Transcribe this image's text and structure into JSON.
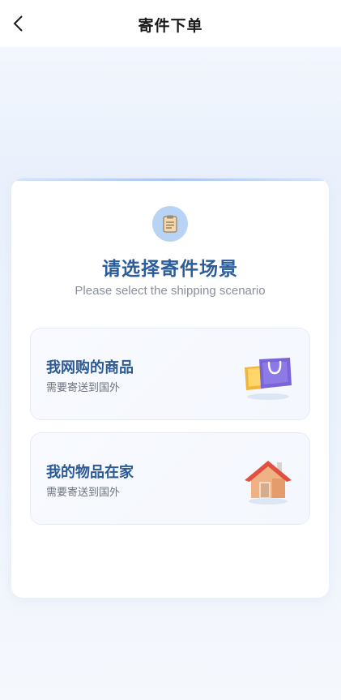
{
  "header": {
    "title": "寄件下单",
    "back_icon": "chevron-left-icon"
  },
  "card": {
    "icon": "clipboard-icon",
    "heading": "请选择寄件场景",
    "subheading": "Please select the shipping scenario"
  },
  "options": [
    {
      "title": "我网购的商品",
      "description": "需要寄送到国外",
      "icon": "shopping-bag-icon"
    },
    {
      "title": "我的物品在家",
      "description": "需要寄送到国外",
      "icon": "house-icon"
    }
  ],
  "colors": {
    "accent": "#2b5d9c",
    "icon_circle": "#b9d3f5",
    "bag_purple": "#7a64d6",
    "bag_yellow": "#f2b63c",
    "roof_red": "#e2503f",
    "house_wall": "#f0b183"
  }
}
